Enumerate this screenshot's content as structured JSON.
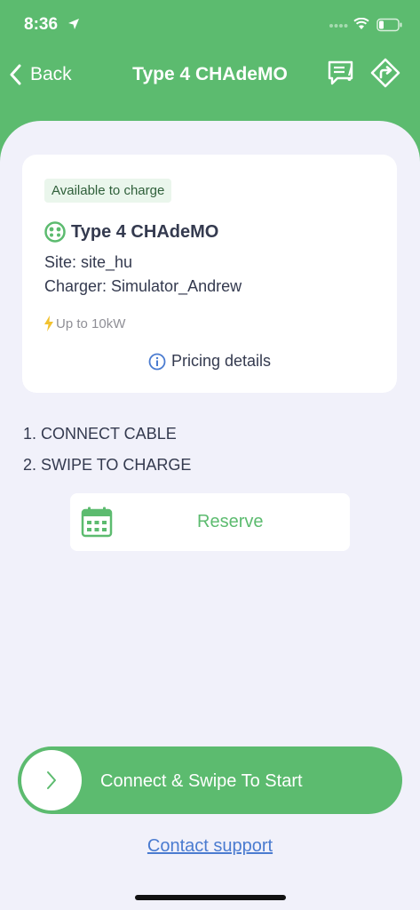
{
  "status_bar": {
    "time": "8:36"
  },
  "nav": {
    "back_label": "Back",
    "title": "Type 4 CHAdeMO"
  },
  "card": {
    "badge": "Available to charge",
    "connector_title": "Type 4 CHAdeMO",
    "site": "Site: site_hu",
    "charger": "Charger: Simulator_Andrew",
    "power": "Up to 10kW",
    "pricing_label": "Pricing details"
  },
  "steps": [
    "1. CONNECT CABLE",
    "2. SWIPE TO CHARGE"
  ],
  "reserve": {
    "label": "Reserve"
  },
  "swipe": {
    "label": "Connect & Swipe To Start"
  },
  "contact": {
    "label": "Contact support"
  },
  "colors": {
    "brand": "#5cbb6f",
    "sheet_bg": "#f1f1fa",
    "text": "#343a4f",
    "link": "#4a7bd0"
  },
  "icons": {
    "nav": [
      "back-chevron-icon",
      "report-icon",
      "directions-icon"
    ],
    "card": [
      "chademo-connector-icon",
      "bolt-icon",
      "info-icon"
    ],
    "reserve": "calendar-icon",
    "swipe": "chevron-right-icon"
  }
}
